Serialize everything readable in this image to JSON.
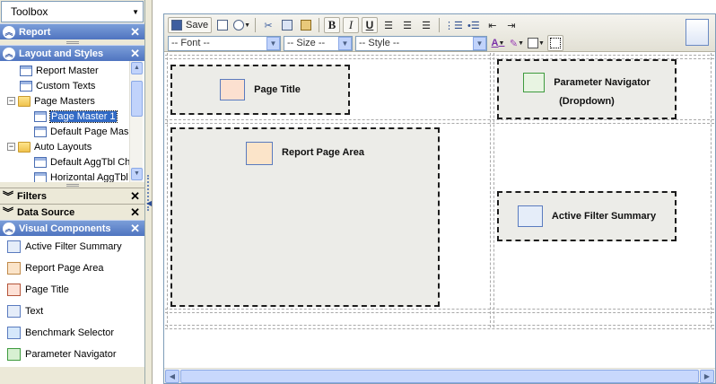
{
  "toolbox": {
    "title": "Toolbox"
  },
  "sections": {
    "report": "Report",
    "layout": "Layout and Styles",
    "filters": "Filters",
    "datasource": "Data Source",
    "visual": "Visual Components"
  },
  "tree": [
    {
      "label": "Report Master",
      "icon": "page-icon"
    },
    {
      "label": "Custom Texts",
      "icon": "page-icon"
    },
    {
      "label": "Page Masters",
      "icon": "folder-icon",
      "expander": "−"
    },
    {
      "label": "Page Master 1",
      "icon": "page-icon",
      "selected": true
    },
    {
      "label": "Default Page Mas",
      "icon": "page-icon"
    },
    {
      "label": "Auto Layouts",
      "icon": "folder-icon",
      "expander": "−"
    },
    {
      "label": "Default AggTbl Ch",
      "icon": "page-icon"
    },
    {
      "label": "Horizontal AggTbl",
      "icon": "page-icon"
    }
  ],
  "components": [
    "Active Filter Summary",
    "Report Page Area",
    "Page Title",
    "Text",
    "Benchmark Selector",
    "Parameter Navigator"
  ],
  "toolbar": {
    "save_label": "Save",
    "bold": "B",
    "italic": "I",
    "underline": "U",
    "font_placeholder": "-- Font --",
    "size_placeholder": "-- Size --",
    "style_placeholder": "-- Style --",
    "font_color_glyph": "A"
  },
  "canvas": {
    "page_title": "Page Title",
    "param_nav_line1": "Parameter Navigator",
    "param_nav_line2": "(Dropdown)",
    "report_page_area": "Report Page Area",
    "active_filter_summary": "Active Filter Summary"
  },
  "colors": {
    "section_header": "#4f74c0",
    "selection": "#316ac5"
  }
}
